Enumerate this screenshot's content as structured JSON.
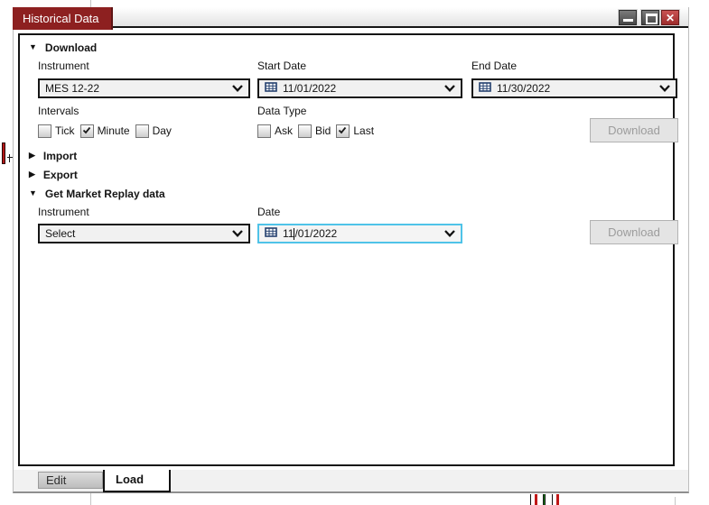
{
  "window": {
    "title": "Historical Data"
  },
  "icons": {
    "expanded_triangle": "▼",
    "collapsed_triangle": "▶",
    "close": "✕"
  },
  "download_section": {
    "header": "Download",
    "instrument": {
      "label": "Instrument",
      "value": "MES 12-22"
    },
    "start_date": {
      "label": "Start Date",
      "value": "11/01/2022"
    },
    "end_date": {
      "label": "End Date",
      "value": "11/30/2022"
    },
    "intervals": {
      "label": "Intervals",
      "options": [
        {
          "label": "Tick",
          "checked": false
        },
        {
          "label": "Minute",
          "checked": true
        },
        {
          "label": "Day",
          "checked": false
        }
      ]
    },
    "data_type": {
      "label": "Data Type",
      "options": [
        {
          "label": "Ask",
          "checked": false
        },
        {
          "label": "Bid",
          "checked": false
        },
        {
          "label": "Last",
          "checked": true
        }
      ]
    },
    "download_button": "Download"
  },
  "import_section": {
    "header": "Import"
  },
  "export_section": {
    "header": "Export"
  },
  "replay_section": {
    "header": "Get Market Replay data",
    "instrument": {
      "label": "Instrument",
      "value": "Select"
    },
    "date": {
      "label": "Date",
      "value_before_caret": "11",
      "value_after_caret": "/01/2022"
    },
    "download_button": "Download"
  },
  "tabs": [
    {
      "label": "Edit",
      "active": false
    },
    {
      "label": "Load",
      "active": true
    }
  ],
  "colors": {
    "title_tab_red": "#8d2020",
    "close_button_red": "#b33e3e",
    "focus_border_cyan": "#4fc3e8",
    "disabled_button_text": "#9c9c9c",
    "candle_red": "#c01818",
    "candle_green": "#1d8a1d"
  }
}
